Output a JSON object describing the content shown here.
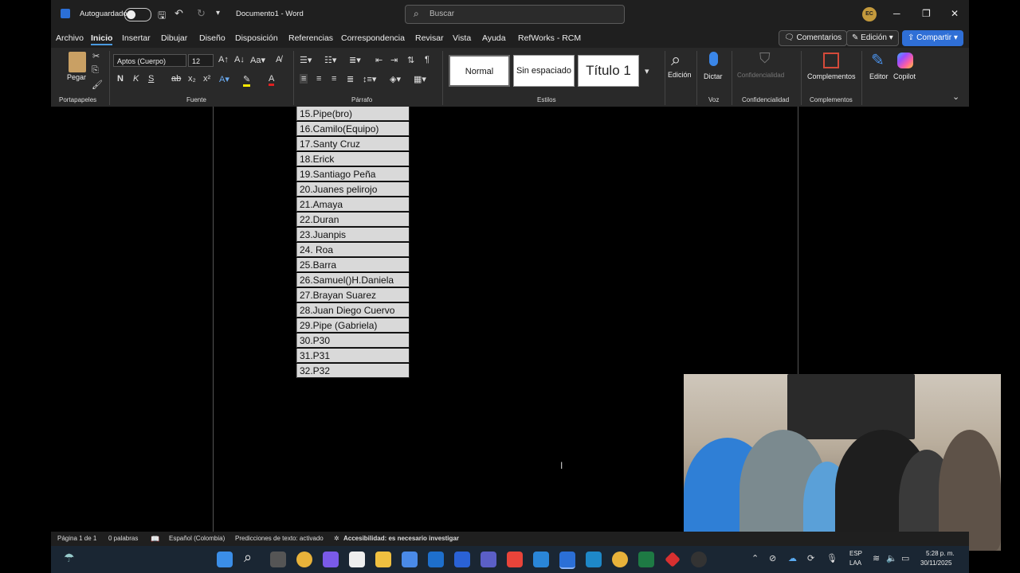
{
  "titlebar": {
    "autosave_label": "Autoguardado",
    "doc_title": "Documento1  -  Word",
    "search_placeholder": "Buscar",
    "avatar_initials": "EC"
  },
  "menu": {
    "tabs": [
      "Archivo",
      "Inicio",
      "Insertar",
      "Dibujar",
      "Diseño",
      "Disposición",
      "Referencias",
      "Correspondencia",
      "Revisar",
      "Vista",
      "Ayuda",
      "RefWorks - RCM"
    ],
    "comments": "Comentarios",
    "editing": "Edición",
    "share": "Compartir"
  },
  "ribbon": {
    "paste": "Pegar",
    "clipboard_group": "Portapapeles",
    "font_name": "Aptos (Cuerpo)",
    "font_size": "12",
    "font_group": "Fuente",
    "paragraph_group": "Párrafo",
    "styles": [
      "Normal",
      "Sin espaciado",
      "Título 1"
    ],
    "styles_group": "Estilos",
    "find": "Edición",
    "dictate": "Dictar",
    "voice_group": "Voz",
    "confidentiality": "Confidencialidad",
    "confidentiality_group": "Confidencialidad",
    "addins": "Complementos",
    "addins_group": "Complementos",
    "editor": "Editor",
    "copilot": "Copilot",
    "bold": "N",
    "italic": "K",
    "underline": "S"
  },
  "document": {
    "names": [
      "15.Pipe(bro)",
      "16.Camilo(Equipo)",
      "17.Santy Cruz",
      "18.Erick",
      "19.Santiago Peña",
      "20.Juanes pelirojo",
      "21.Amaya",
      "22.Duran",
      "23.Juanpis",
      "24. Roa",
      "25.Barra",
      "26.Samuel()H.Daniela",
      "27.Brayan Suarez",
      "28.Juan Diego Cuervo",
      "29.Pipe (Gabriela)",
      "30.P30",
      "31.P31",
      "32.P32"
    ]
  },
  "status": {
    "page": "Página 1 de 1",
    "words": "0 palabras",
    "language": "Español (Colombia)",
    "predictions": "Predicciones de texto: activado",
    "accessibility": "Accesibilidad: es necesario investigar"
  },
  "taskbar": {
    "lang1": "ESP",
    "lang2": "LAA",
    "time": "5:28 p. m.",
    "date": "30/11/2025"
  }
}
